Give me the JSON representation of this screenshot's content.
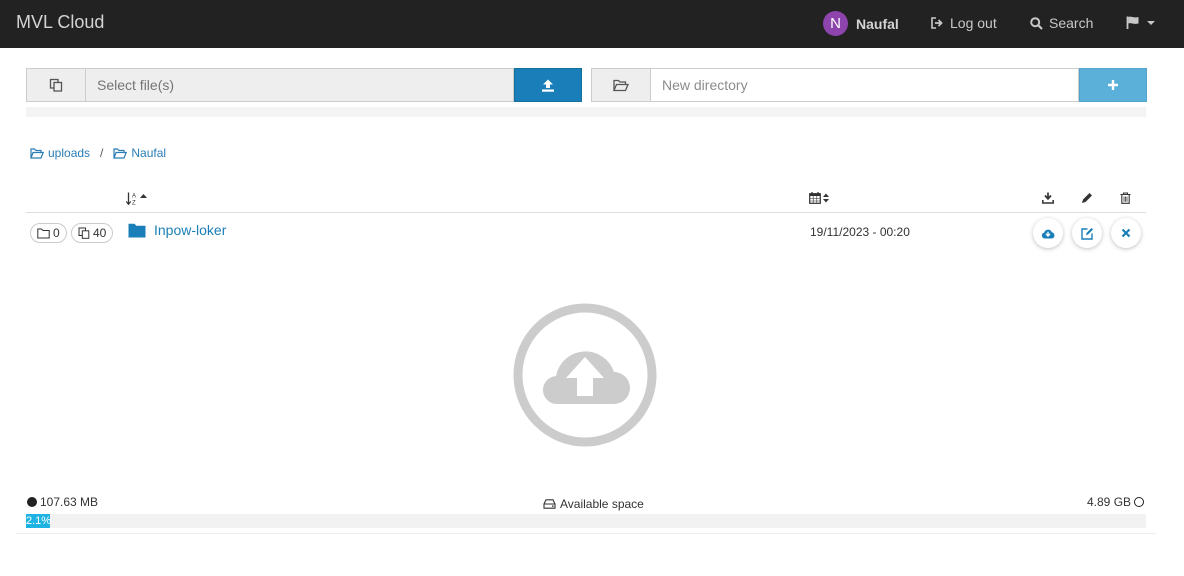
{
  "app": {
    "title": "MVL Cloud"
  },
  "nav": {
    "user_initial": "N",
    "user_name": "Naufal",
    "avatar_color": "#8e44ad",
    "logout_label": "Log out",
    "search_label": "Search"
  },
  "upload": {
    "placeholder": "Select file(s)"
  },
  "mkdir": {
    "placeholder": "New directory"
  },
  "breadcrumb": [
    {
      "label": "uploads"
    },
    {
      "label": "Naufal"
    }
  ],
  "breadcrumb_separator": "/",
  "table": {
    "rows": [
      {
        "dirs": "0",
        "files": "40",
        "name": "Inpow-loker",
        "date": "19/11/2023 - 00:20"
      }
    ]
  },
  "storage": {
    "used": "107.63 MB",
    "available_label": "Available space",
    "total": "4.89 GB",
    "percent_label": "2.1%",
    "percent": 2.1,
    "bar_color": "#1fb3e3"
  },
  "colors": {
    "navbar": "#222222",
    "primary": "#1a7fb8",
    "add_button": "#5bb0d9"
  }
}
